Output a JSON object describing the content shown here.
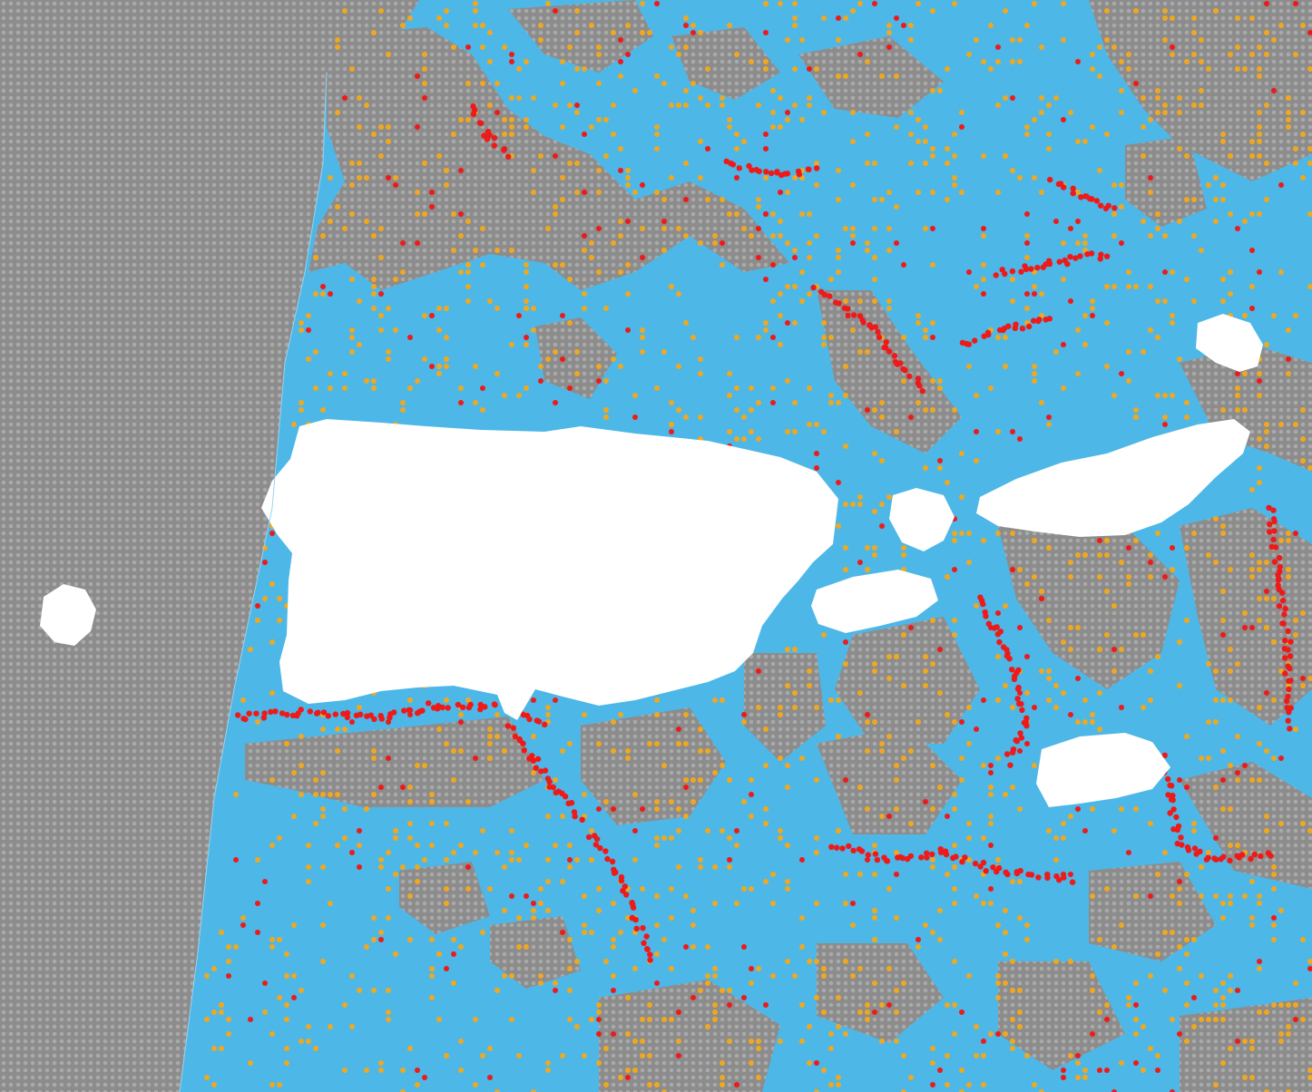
{
  "map": {
    "type": "classified-raster",
    "orientation": "north-up",
    "has_title": false,
    "has_legend": false,
    "has_axes": false,
    "classes": [
      {
        "key": "nodata",
        "color": "#8c8c8c",
        "label": ""
      },
      {
        "key": "water",
        "color": "#4db7e7",
        "label": ""
      },
      {
        "key": "low",
        "color": "#f0a820",
        "label": ""
      },
      {
        "key": "high",
        "color": "#ee1a1a",
        "label": ""
      },
      {
        "key": "land",
        "color": "#ffffff",
        "label": ""
      }
    ],
    "dot_texture": {
      "nodata_dot": "#a9a9a9",
      "grid_step": 8
    }
  }
}
